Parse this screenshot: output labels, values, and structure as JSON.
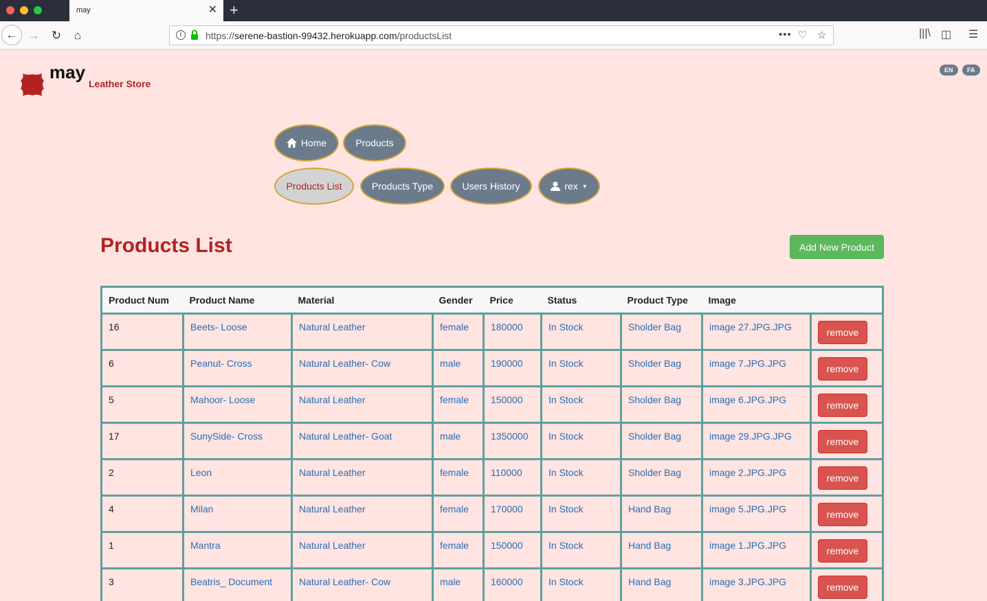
{
  "browser": {
    "tab_title": "may",
    "url_prefix": "https://",
    "url_host": "serene-bastion-99432.herokuapp.com",
    "url_path": "/productsList"
  },
  "brand": {
    "name": "may",
    "subtitle": "Leather Store",
    "accent_color": "#b22222"
  },
  "languages": [
    "EN",
    "FA"
  ],
  "nav": {
    "home": "Home",
    "products": "Products",
    "products_list": "Products List",
    "products_type": "Products Type",
    "users_history": "Users History",
    "user": "rex"
  },
  "page": {
    "title": "Products List",
    "add_button": "Add New Product"
  },
  "table": {
    "columns": [
      "Product Num",
      "Product Name",
      "Material",
      "Gender",
      "Price",
      "Status",
      "Product Type",
      "Image"
    ],
    "remove_label": "remove",
    "rows": [
      [
        "16",
        "Beets- Loose",
        "Natural Leather",
        "female",
        "180000",
        "In Stock",
        "Sholder Bag",
        "image 27.JPG.JPG"
      ],
      [
        "6",
        "Peanut- Cross",
        "Natural Leather- Cow",
        "male",
        "190000",
        "In Stock",
        "Sholder Bag",
        "image 7.JPG.JPG"
      ],
      [
        "5",
        "Mahoor- Loose",
        "Natural Leather",
        "female",
        "150000",
        "In Stock",
        "Sholder Bag",
        "image 6.JPG.JPG"
      ],
      [
        "17",
        "SunySide- Cross",
        "Natural Leather- Goat",
        "male",
        "1350000",
        "In Stock",
        "Sholder Bag",
        "image 29.JPG.JPG"
      ],
      [
        "2",
        "Leon",
        "Natural Leather",
        "female",
        "110000",
        "In Stock",
        "Sholder Bag",
        "image 2.JPG.JPG"
      ],
      [
        "4",
        "Milan",
        "Natural Leather",
        "female",
        "170000",
        "In Stock",
        "Hand Bag",
        "image 5.JPG.JPG"
      ],
      [
        "1",
        "Mantra",
        "Natural Leather",
        "female",
        "150000",
        "In Stock",
        "Hand Bag",
        "image 1.JPG.JPG"
      ],
      [
        "3",
        "Beatris_ Document",
        "Natural Leather- Cow",
        "male",
        "160000",
        "In Stock",
        "Hand Bag",
        "image 3.JPG.JPG"
      ]
    ]
  }
}
